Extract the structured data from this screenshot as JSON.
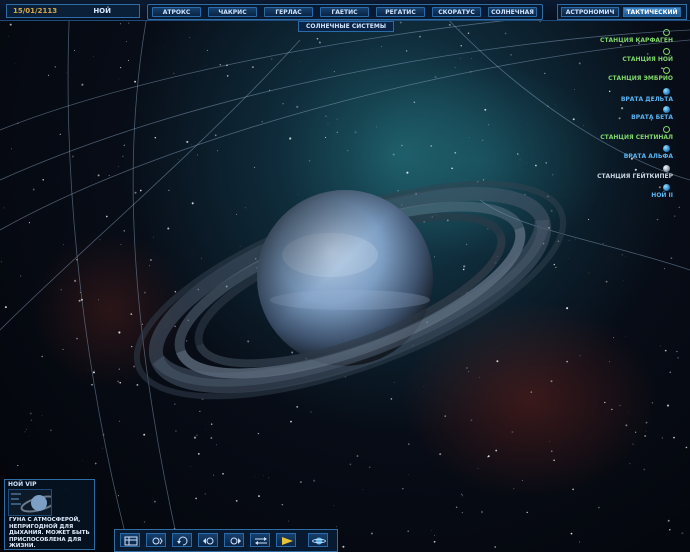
{
  "header": {
    "date": "15/01/2113",
    "player_name": "НОЙ"
  },
  "systems": {
    "tabs": [
      "АТРОКС",
      "ЧАКРИС",
      "ГЕРЛАС",
      "ГАЕТИС",
      "РЕГАТИС",
      "СКОРАТУС",
      "СОЛНЕЧНАЯ"
    ],
    "subtitle": "СОЛНЕЧНЫЕ СИСТЕМЫ"
  },
  "view": {
    "tabs": [
      "АСТРОНОМИЧ",
      "ТАКТИЧЕСКИЙ"
    ],
    "active": "ТАКТИЧЕСКИЙ"
  },
  "stations": [
    {
      "label": "СТАНЦИЯ КАРФАГЕН",
      "color": "green",
      "icon": "station-ring-icon"
    },
    {
      "label": "СТАНЦИЯ НОЙ",
      "color": "green",
      "icon": "station-ring-icon"
    },
    {
      "label": "СТАНЦИЯ ЭМБРИО",
      "color": "green",
      "icon": "station-ring-icon"
    },
    {
      "label": "ВРАТА ДЕЛЬТА",
      "color": "blue",
      "icon": "gate-orb-icon"
    },
    {
      "label": "ВРАТА БЕТА",
      "color": "blue",
      "icon": "gate-orb-icon"
    },
    {
      "label": "СТАНЦИЯ СЕНТИНАЛ",
      "color": "green",
      "icon": "station-ring-icon"
    },
    {
      "label": "ВРАТА АЛЬФА",
      "color": "blue",
      "icon": "gate-orb-icon"
    },
    {
      "label": "СТАНЦИЯ ГЕЙТКИПЕР",
      "color": "grey",
      "icon": "station-info-icon"
    },
    {
      "label": "НОЙ II",
      "color": "blue",
      "icon": "planet-orb-icon"
    }
  ],
  "info_panel": {
    "title": "НОЙ VIP",
    "description": "ГУНА С АТМОСФЕРОЙ, НЕПРИГОДНОЙ ДЛЯ ДЫХАНИЯ. МОЖЕТ БЫТЬ ПРИСПОСОБЛЕНА ДЛЯ ЖИЗНИ."
  },
  "toolbar": {
    "buttons": [
      "galaxy-map-icon",
      "camera-zoom-icon",
      "camera-rotate-icon",
      "camera-left-icon",
      "camera-right-icon",
      "swap-icon",
      "play-icon",
      "planet-icon"
    ]
  },
  "colors": {
    "accent": "#2f6da6",
    "active_tab": "#3a86c8",
    "date": "#d8a84a",
    "station_green": "#7fd46a",
    "gate_blue": "#5ab3f0"
  }
}
